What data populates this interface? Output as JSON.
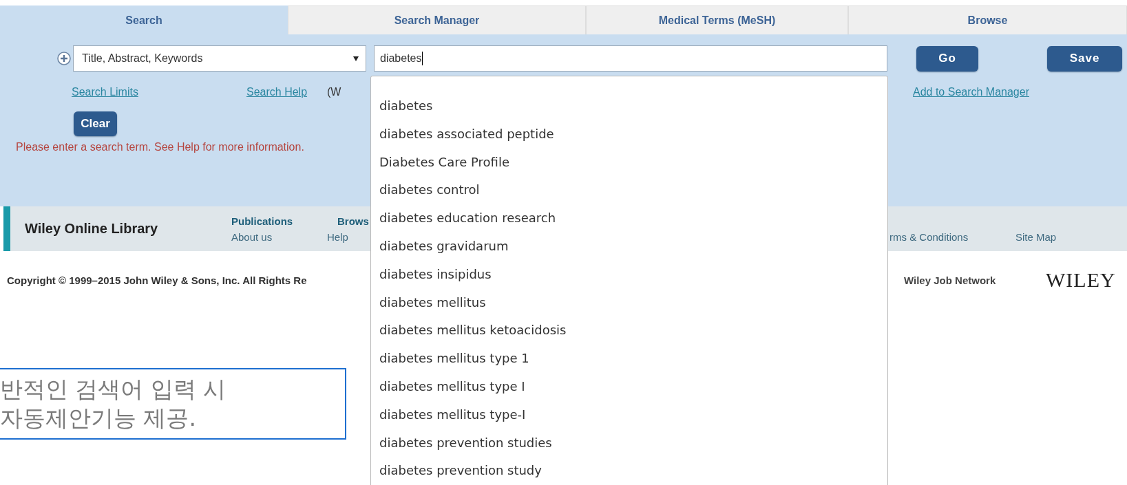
{
  "tabs": [
    {
      "label": "Search",
      "selected": true
    },
    {
      "label": "Search Manager",
      "selected": false
    },
    {
      "label": "Medical Terms (MeSH)",
      "selected": false
    },
    {
      "label": "Browse",
      "selected": false
    }
  ],
  "search": {
    "field_select": "Title, Abstract, Keywords",
    "query": "diabetes",
    "go_button": "Go",
    "save_button": "Save",
    "links": [
      "Search Limits",
      "Search Help"
    ],
    "hint_fragment": "(W",
    "add_link": "Add to Search Manager",
    "clear_button": "Clear",
    "error": "Please enter a search term. See Help for more information."
  },
  "footer": {
    "title": "Wiley Online Library",
    "nav_top": [
      "Publications",
      "Brows"
    ],
    "nav_bottom": [
      "About us",
      "Help",
      "rms & Conditions",
      "Site Map"
    ],
    "copyright": "Copyright © 1999–2015 John Wiley & Sons, Inc. All Rights Re",
    "job_network": "Wiley Job Network",
    "logo": "WILEY"
  },
  "suggestions": [
    "diabetes",
    "diabetes associated peptide",
    "Diabetes Care Profile",
    "diabetes control",
    "diabetes education research",
    "diabetes gravidarum",
    "diabetes insipidus",
    "diabetes mellitus",
    "diabetes mellitus ketoacidosis",
    "diabetes mellitus type 1",
    "diabetes mellitus type I",
    "diabetes mellitus type-I",
    "diabetes prevention studies",
    "diabetes prevention study"
  ],
  "annotation": {
    "lines": [
      "반적인 검색어 입력 시",
      "자동제안기능 제공."
    ]
  }
}
